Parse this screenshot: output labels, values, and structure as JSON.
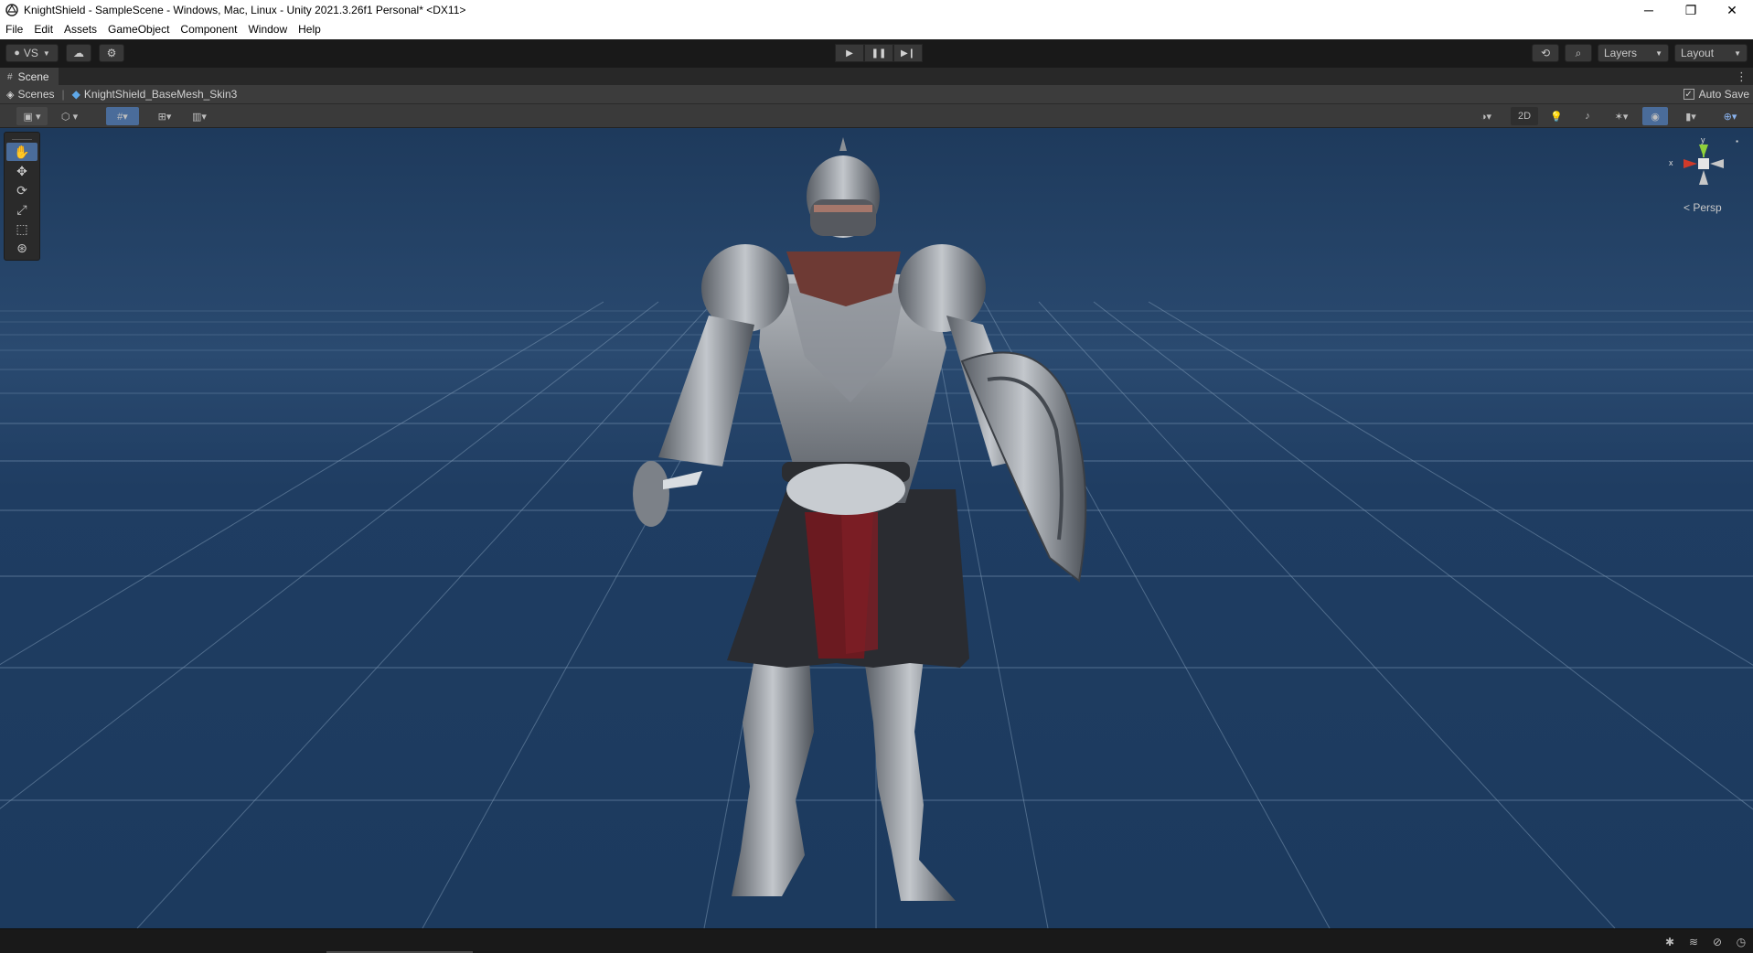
{
  "window": {
    "title": "KnightShield - SampleScene - Windows, Mac, Linux - Unity 2021.3.26f1 Personal* <DX11>",
    "controls": [
      "─",
      "❐",
      "✕"
    ]
  },
  "menu": [
    "File",
    "Edit",
    "Assets",
    "GameObject",
    "Component",
    "Window",
    "Help"
  ],
  "toolbar": {
    "account_label": "VS",
    "layers_label": "Layers",
    "layout_label": "Layout"
  },
  "scene_tab": {
    "label": "Scene",
    "breadcrumb_root": "Scenes",
    "breadcrumb_item": "KnightShield_BaseMesh_Skin3",
    "autosave_label": "Auto Save",
    "autosave_checked": true
  },
  "overlay": {
    "mode_2d": "2D"
  },
  "gizmo": {
    "projection_label": "Persp",
    "x_label": "x",
    "y_label": "y",
    "colors": {
      "x": "#d03a2a",
      "y": "#8fd13b",
      "z": "#3b7dd8"
    }
  },
  "colors": {
    "viewport_bg": "#1e3a5c",
    "grid_line": "#7f9bb8",
    "active_tool": "#4a6c9a"
  }
}
